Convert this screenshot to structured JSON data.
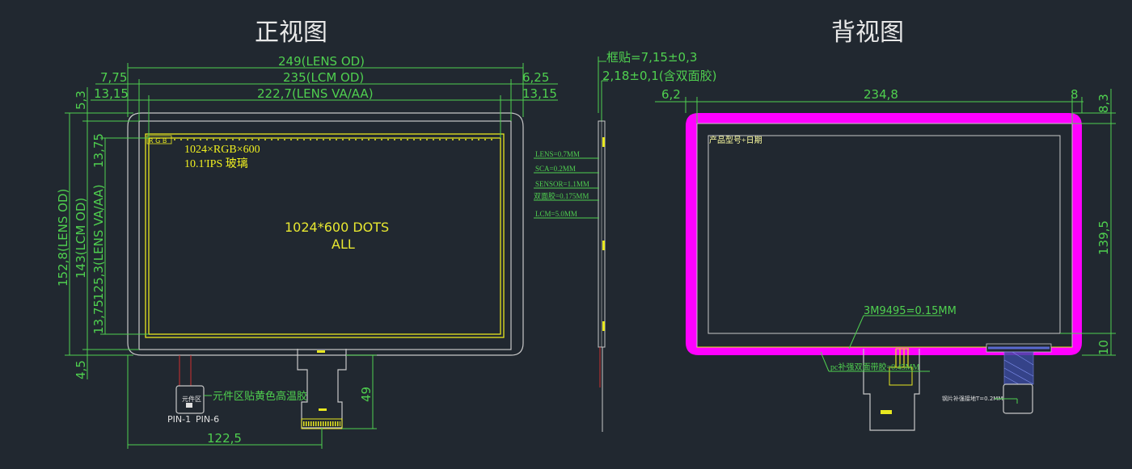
{
  "titles": {
    "front": "正视图",
    "back": "背视图"
  },
  "front_view": {
    "dims": {
      "lens_od": "249(LENS OD)",
      "lcm_od": "235(LCM OD)",
      "lens_va": "222,7(LENS VA/AA)",
      "left_775": "7,75",
      "right_625": "6,25",
      "left_1315": "13,15",
      "right_1315": "13,15",
      "top_53": "5,3",
      "v_lens_od": "152,8(LENS OD)",
      "v_lcm_od": "143(LCM OD)",
      "v_lens_va": "125,3(LENS VA/AA)",
      "v_1375_top": "13,75",
      "v_1375_bottom": "13,75",
      "v_45": "4,5",
      "fpc_49": "49",
      "bottom_1225": "122,5"
    },
    "labels": {
      "rgb": "R G B",
      "resolution": "1024×RGB×600",
      "model": "10.1'IPS  玻璃",
      "dots": "1024*600   DOTS",
      "all": "ALL",
      "component_area": "元件区",
      "glue_note": "元件区贴黄色高温胶",
      "pin1": "PIN-1",
      "pin6": "PIN-6"
    }
  },
  "side_view": {
    "frame_note": "框贴=7,15±0,3",
    "tape_note": "2,18±0,1(含双面胶)",
    "layers": [
      "LENS=0.7MM",
      "SCA=0.2MM",
      "SENSOR=1.1MM",
      "双面胶=0.175MM",
      "LCM=5.0MM"
    ]
  },
  "back_view": {
    "dims": {
      "left_62": "6,2",
      "width_2348": "234,8",
      "right_8": "8",
      "top_83": "8,3",
      "height_1395": "139,5",
      "bottom_10": "10"
    },
    "labels": {
      "product_date": "产品型号+日期",
      "tape_3m": "3M9495=0.15MM",
      "pc_tape": "pc补强双面带胶=0.45MM",
      "steel_note": "钢片补强接地T=0.2MM"
    }
  }
}
